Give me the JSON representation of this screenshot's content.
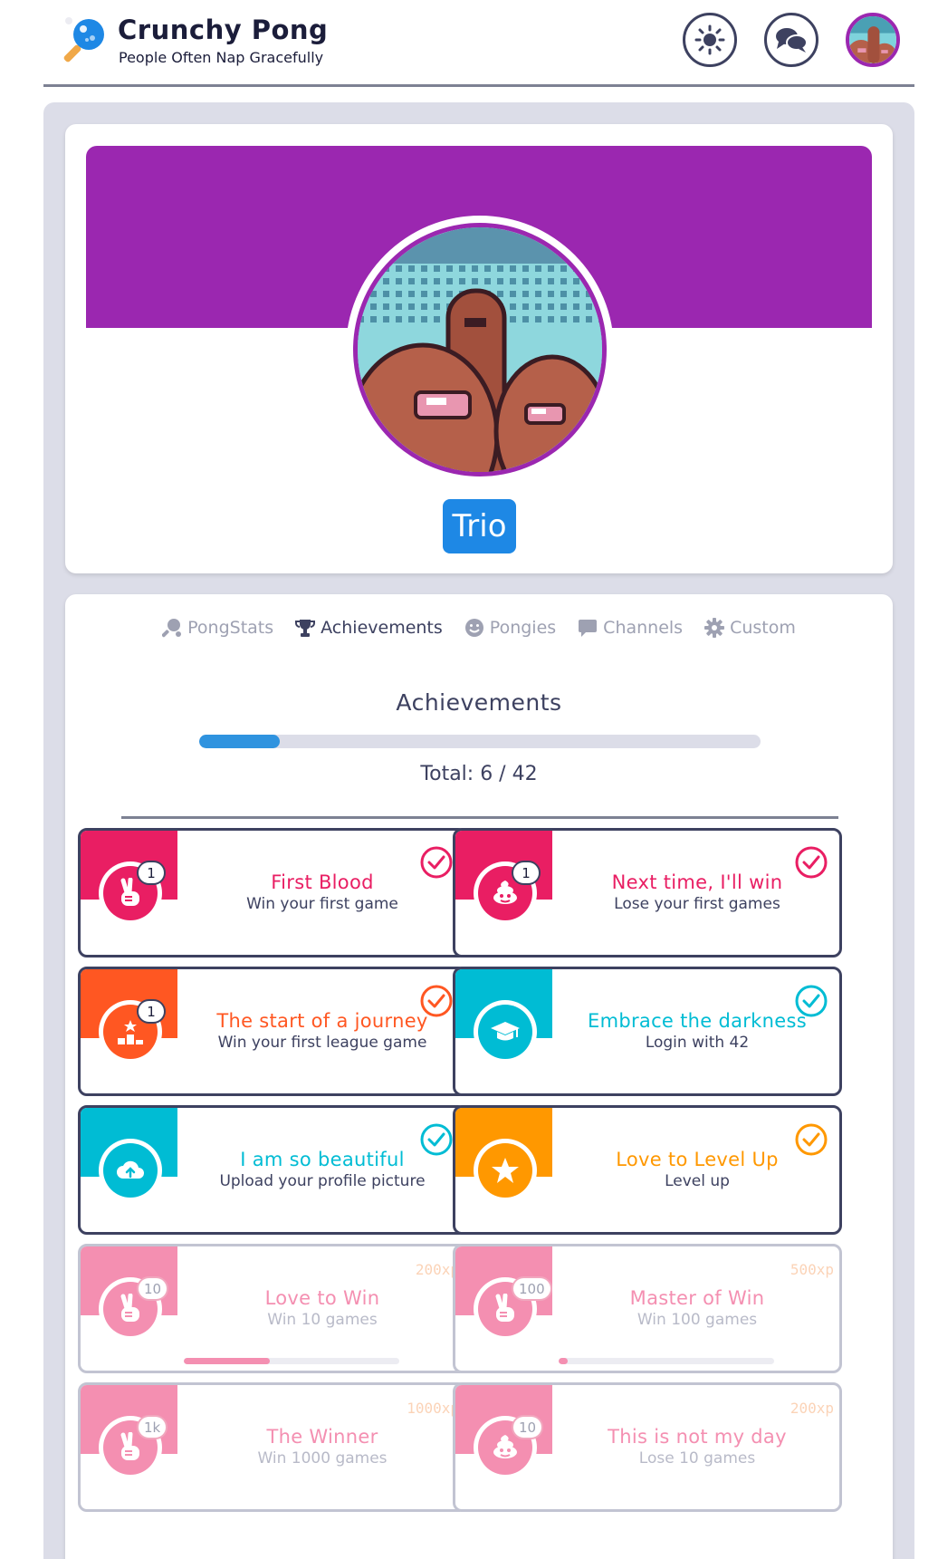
{
  "header": {
    "app_title": "Crunchy Pong",
    "app_subtitle": "People Often Nap Gracefully",
    "icons": [
      "theme-sun-icon",
      "chat-bubbles-icon",
      "user-avatar"
    ]
  },
  "profile": {
    "username": "Trio",
    "banner_color": "#9b27b0",
    "badge_color": "#1e88e5"
  },
  "tabs": [
    {
      "label": "PongStats",
      "icon": "pong-paddle-icon",
      "active": false
    },
    {
      "label": "Achievements",
      "icon": "trophy-icon",
      "active": true
    },
    {
      "label": "Pongies",
      "icon": "smiley-icon",
      "active": false
    },
    {
      "label": "Channels",
      "icon": "chat-bubble-icon",
      "active": false
    },
    {
      "label": "Custom",
      "icon": "gear-icon",
      "active": false
    }
  ],
  "achievements_section": {
    "title": "Achievements",
    "progress_fraction": 0.1429,
    "total_label": "Total: 6 / 42"
  },
  "achievements": [
    {
      "title": "First Blood",
      "desc": "Win your first game",
      "color": "#e91e63",
      "icon": "victory-hand-icon",
      "count": "1",
      "done": true
    },
    {
      "title": "Next time, I'll win",
      "desc": "Lose your first games",
      "color": "#e91e63",
      "icon": "poop-icon",
      "count": "1",
      "done": true
    },
    {
      "title": "The start of a journey",
      "desc": "Win your first league game",
      "color": "#ff5722",
      "icon": "podium-icon",
      "count": "1",
      "done": true
    },
    {
      "title": "Embrace the darkness",
      "desc": "Login with 42",
      "color": "#00bcd4",
      "icon": "graduation-cap-icon",
      "count": "",
      "done": true
    },
    {
      "title": "I am so beautiful",
      "desc": "Upload your profile picture",
      "color": "#00bcd4",
      "icon": "cloud-upload-icon",
      "count": "",
      "done": true
    },
    {
      "title": "Love to Level Up",
      "desc": "Level up",
      "color": "#ff9800",
      "icon": "star-icon",
      "count": "",
      "done": true
    },
    {
      "title": "Love to Win",
      "desc": "Win 10 games",
      "color": "#f48fb1",
      "icon": "victory-hand-icon",
      "count": "10",
      "done": false,
      "xp": "200xp",
      "progress": 0.4
    },
    {
      "title": "Master of Win",
      "desc": "Win 100 games",
      "color": "#f48fb1",
      "icon": "victory-hand-icon",
      "count": "100",
      "done": false,
      "xp": "500xp",
      "progress": 0.04
    },
    {
      "title": "The Winner",
      "desc": "Win 1000 games",
      "color": "#f48fb1",
      "icon": "victory-hand-icon",
      "count": "1k",
      "done": false,
      "xp": "1000xp"
    },
    {
      "title": "This is not my day",
      "desc": "Lose 10 games",
      "color": "#f48fb1",
      "icon": "poop-icon",
      "count": "10",
      "done": false,
      "xp": "200xp"
    }
  ]
}
